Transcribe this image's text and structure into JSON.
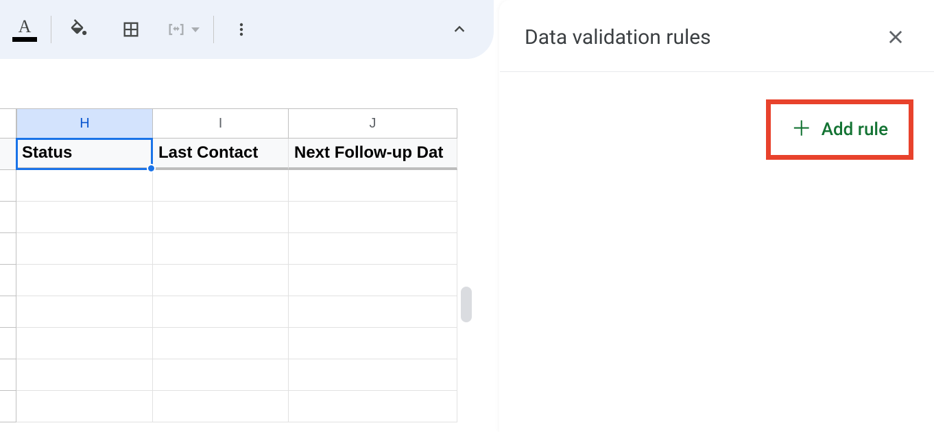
{
  "toolbar": {
    "text_color_letter": "A"
  },
  "columns": {
    "h": "H",
    "i": "I",
    "j": "J"
  },
  "headers": {
    "h": "Status",
    "i": "Last Contact",
    "j": "Next Follow-up Dat"
  },
  "panel": {
    "title": "Data validation rules",
    "add_rule_label": "Add rule"
  }
}
